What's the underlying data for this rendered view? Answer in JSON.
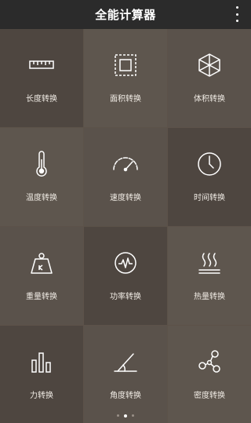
{
  "app": {
    "title": "全能计算器"
  },
  "colors": {
    "titlebar": "#2b2b2b",
    "tile_dark": "#4d4540",
    "tile_light": "#5f574f",
    "tile_medium": "#56504a"
  },
  "tiles": [
    {
      "label": "长度转换",
      "icon": "ruler-icon"
    },
    {
      "label": "面积转换",
      "icon": "square-area-icon"
    },
    {
      "label": "体积转换",
      "icon": "cube-icon"
    },
    {
      "label": "温度转换",
      "icon": "thermometer-icon"
    },
    {
      "label": "速度转换",
      "icon": "speedometer-icon"
    },
    {
      "label": "时间转换",
      "icon": "clock-icon"
    },
    {
      "label": "重量转换",
      "icon": "weight-icon"
    },
    {
      "label": "功率转换",
      "icon": "power-meter-icon"
    },
    {
      "label": "热量转换",
      "icon": "heat-icon"
    },
    {
      "label": "力转换",
      "icon": "bar-chart-icon"
    },
    {
      "label": "角度转换",
      "icon": "angle-icon"
    },
    {
      "label": "密度转换",
      "icon": "molecule-icon"
    }
  ],
  "pager": {
    "pages": 3,
    "active_index": 1
  }
}
